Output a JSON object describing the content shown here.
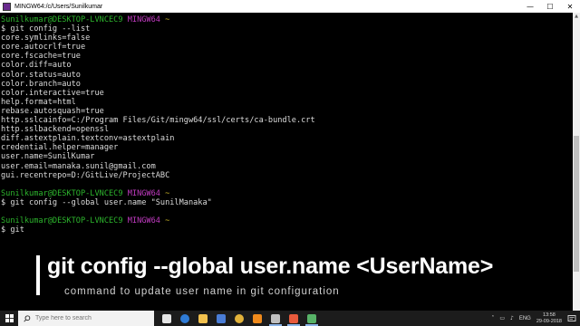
{
  "window": {
    "title": "MINGW64:/c/Users/Sunilkumar",
    "minimize": "—",
    "maximize": "☐",
    "close": "✕"
  },
  "terminal": {
    "lines": [
      {
        "type": "prompt",
        "user": "Sunilkumar@DESKTOP-LVNCEC9",
        "env": "MINGW64",
        "path": "~"
      },
      {
        "type": "text",
        "text": "$ git config --list"
      },
      {
        "type": "text",
        "text": "core.symlinks=false"
      },
      {
        "type": "text",
        "text": "core.autocrlf=true"
      },
      {
        "type": "text",
        "text": "core.fscache=true"
      },
      {
        "type": "text",
        "text": "color.diff=auto"
      },
      {
        "type": "text",
        "text": "color.status=auto"
      },
      {
        "type": "text",
        "text": "color.branch=auto"
      },
      {
        "type": "text",
        "text": "color.interactive=true"
      },
      {
        "type": "text",
        "text": "help.format=html"
      },
      {
        "type": "text",
        "text": "rebase.autosquash=true"
      },
      {
        "type": "text",
        "text": "http.sslcainfo=C:/Program Files/Git/mingw64/ssl/certs/ca-bundle.crt"
      },
      {
        "type": "text",
        "text": "http.sslbackend=openssl"
      },
      {
        "type": "text",
        "text": "diff.astextplain.textconv=astextplain"
      },
      {
        "type": "text",
        "text": "credential.helper=manager"
      },
      {
        "type": "text",
        "text": "user.name=SunilKumar"
      },
      {
        "type": "text",
        "text": "user.email=manaka.sunil@gmail.com"
      },
      {
        "type": "text",
        "text": "gui.recentrepo=D:/GitLive/ProjectABC"
      },
      {
        "type": "text",
        "text": ""
      },
      {
        "type": "prompt",
        "user": "Sunilkumar@DESKTOP-LVNCEC9",
        "env": "MINGW64",
        "path": "~"
      },
      {
        "type": "text",
        "text": "$ git config --global user.name \"SunilManaka\""
      },
      {
        "type": "text",
        "text": ""
      },
      {
        "type": "prompt",
        "user": "Sunilkumar@DESKTOP-LVNCEC9",
        "env": "MINGW64",
        "path": "~"
      },
      {
        "type": "text",
        "text": "$ git"
      }
    ]
  },
  "overlay": {
    "headline": "git config --global user.name <UserName>",
    "subtitle": "command to  update user name in git configuration"
  },
  "taskbar": {
    "search_placeholder": "Type here to search",
    "apps": [
      {
        "name": "task-view-icon",
        "color": "#e6e6e6"
      },
      {
        "name": "edge-icon",
        "color": "#2f7bd6"
      },
      {
        "name": "file-explorer-icon",
        "color": "#f2c14e"
      },
      {
        "name": "store-icon",
        "color": "#4a7dd6"
      },
      {
        "name": "chrome-icon",
        "color": "#e2b23a"
      },
      {
        "name": "vlc-icon",
        "color": "#f08a1c"
      },
      {
        "name": "git-bash-icon",
        "color": "#c0c0c0"
      },
      {
        "name": "app-icon",
        "color": "#e85a3c"
      },
      {
        "name": "gitkraken-icon",
        "color": "#58b368"
      }
    ],
    "language": "ENG",
    "time": "13:58",
    "date": "29-09-2018"
  }
}
